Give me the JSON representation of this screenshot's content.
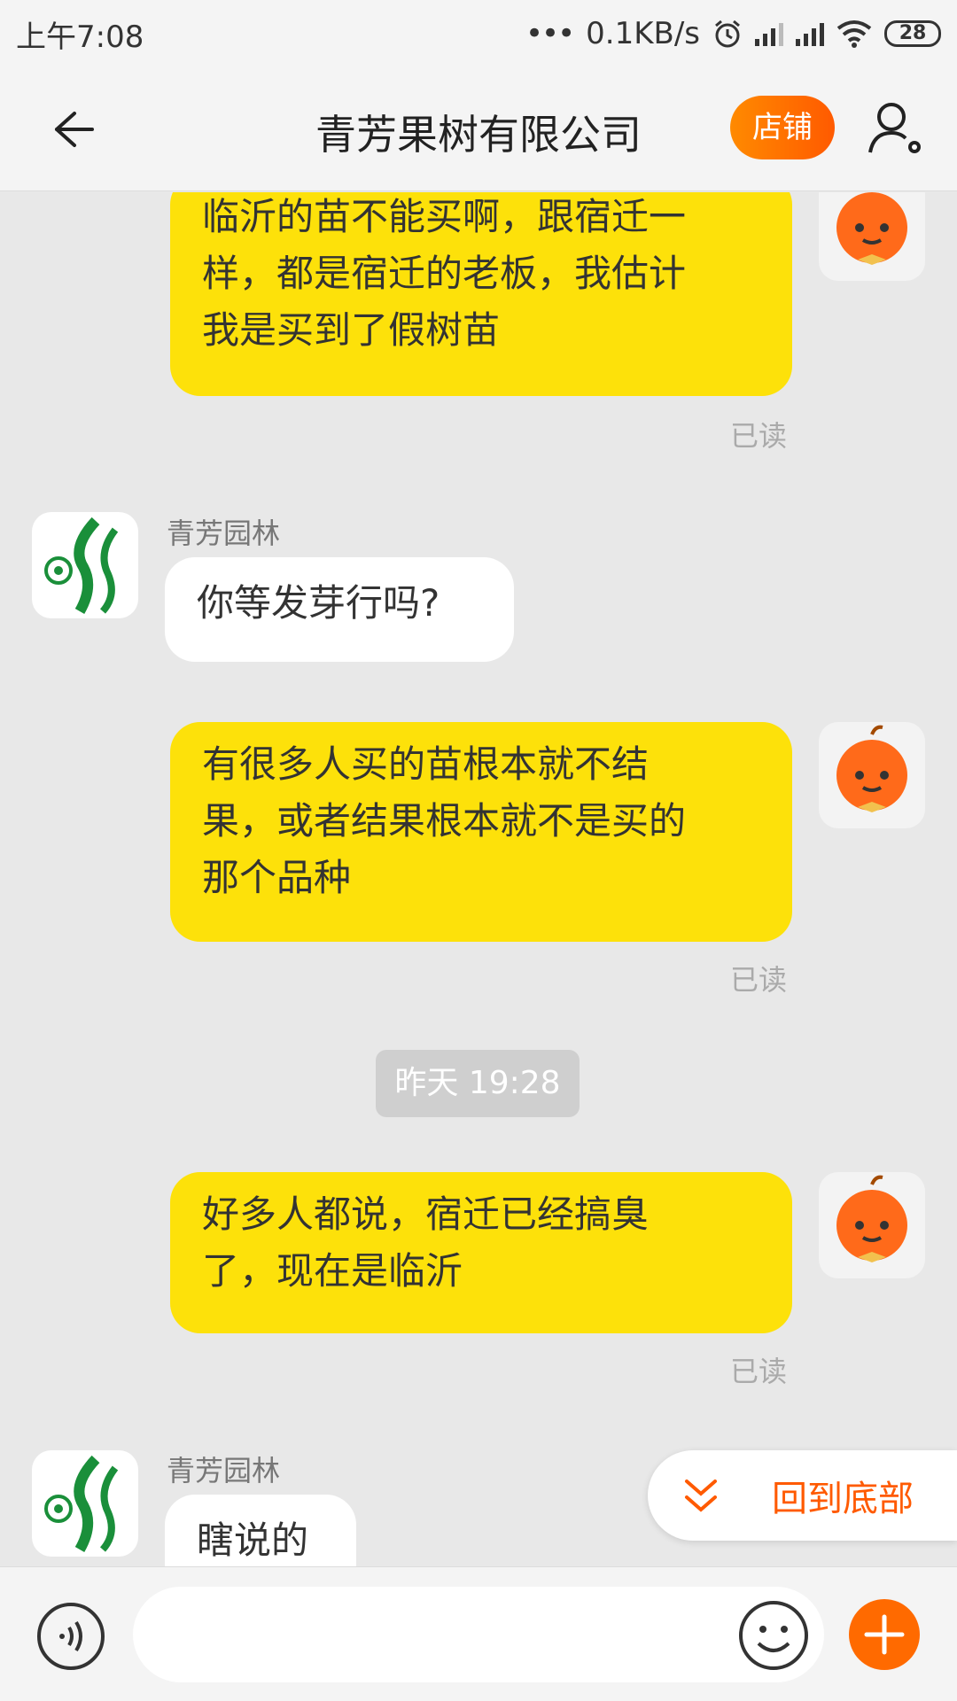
{
  "status_bar": {
    "time": "上午7:08",
    "network_speed": "0.1KB/s",
    "battery": "28"
  },
  "nav": {
    "title": "青芳果树有限公司",
    "shop_label": "店铺"
  },
  "messages": [
    {
      "from": "me",
      "text_lines": [
        "临沂的苗不能买啊，跟宿迁一",
        "样，都是宿迁的老板，我估计",
        "我是买到了假树苗"
      ],
      "status": "已读"
    },
    {
      "from": "them",
      "sender": "青芳园林",
      "text": "你等发芽行吗?"
    },
    {
      "from": "me",
      "text_lines": [
        "有很多人买的苗根本就不结",
        "果，或者结果根本就不是买的",
        "那个品种"
      ],
      "status": "已读"
    },
    {
      "time_divider": "昨天  19:28"
    },
    {
      "from": "me",
      "text_lines": [
        "好多人都说，宿迁已经搞臭",
        "了，现在是临沂"
      ],
      "status": "已读"
    },
    {
      "from": "them",
      "sender": "青芳园林",
      "text": "瞎说的"
    }
  ],
  "back_to_bottom_label": "回到底部",
  "colors": {
    "my_bubble": "#fde10a",
    "accent": "#ff6a00",
    "brand_green": "#1a8f3a"
  },
  "icons": {
    "back": "back-arrow-icon",
    "user_settings": "user-settings-icon",
    "voice": "voice-icon",
    "emoji": "emoji-icon",
    "plus": "plus-icon",
    "chevron": "double-chevron-down-icon"
  }
}
